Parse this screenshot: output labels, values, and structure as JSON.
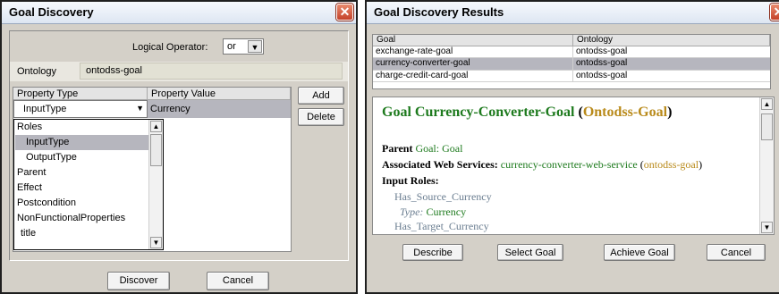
{
  "discovery": {
    "title": "Goal Discovery",
    "close_glyph": "✕",
    "logical_operator_label": "Logical Operator:",
    "logical_operator_value": "or",
    "ontology_label": "Ontology",
    "ontology_value": "ontodss-goal",
    "property_type_header": "Property Type",
    "property_value_header": "Property Value",
    "selected_property_type": "InputType",
    "property_value": "Currency",
    "add_label": "Add",
    "delete_label": "Delete",
    "dropdown_items": [
      "Roles",
      "InputType",
      "OutputType",
      "Parent",
      "Effect",
      "Postcondition",
      "NonFunctionalProperties",
      "title"
    ],
    "discover_label": "Discover",
    "cancel_label": "Cancel"
  },
  "results": {
    "title": "Goal Discovery Results",
    "col_goal": "Goal",
    "col_ontology": "Ontology",
    "rows": [
      {
        "goal": "exchange-rate-goal",
        "ontology": "ontodss-goal"
      },
      {
        "goal": "currency-converter-goal",
        "ontology": "ontodss-goal"
      },
      {
        "goal": "charge-credit-card-goal",
        "ontology": "ontodss-goal"
      }
    ],
    "detail": {
      "heading_prefix": "Goal Currency-Converter-Goal",
      "heading_ontology": "Ontodss-Goal",
      "parent_label": "Parent",
      "parent_goal_word": "Goal:",
      "parent_value": "Goal",
      "assoc_label": "Associated Web Services:",
      "assoc_value": "currency-converter-web-service",
      "assoc_ontology": "ontodss-goal",
      "input_roles_label": "Input Roles:",
      "role1": "Has_Source_Currency",
      "type_label": "Type:",
      "type_value": "Currency",
      "role2": "Has_Target_Currency"
    },
    "describe_label": "Describe",
    "select_goal_label": "Select Goal",
    "achieve_goal_label": "Achieve Goal",
    "cancel_label": "Cancel"
  },
  "colors": {
    "heading_green": "#1d7a1d",
    "ontology_gold": "#b98a1a",
    "role_gray": "#6a7d90",
    "selection": "#b6b6be"
  }
}
